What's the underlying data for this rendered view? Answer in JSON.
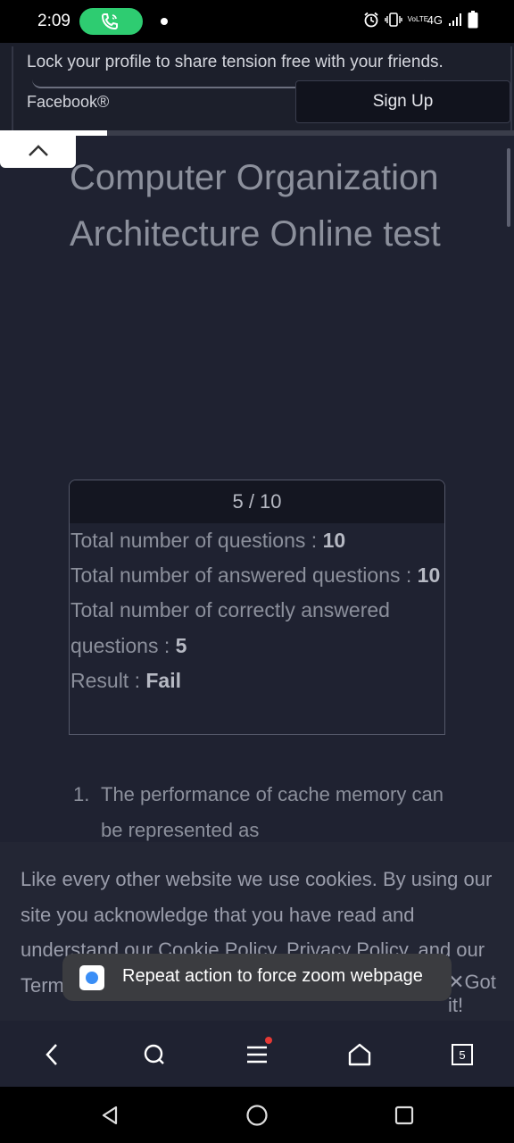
{
  "status_bar": {
    "time": "2:09",
    "network": "4G",
    "volte": "VoLTE",
    "icons": [
      "phone-call-icon",
      "alarm-icon",
      "vibrate-icon",
      "signal-icon",
      "battery-icon"
    ]
  },
  "banner": {
    "text": "Lock your profile to share tension free with your friends.",
    "brand": "Facebook®",
    "signup_label": "Sign Up"
  },
  "page": {
    "title": "Computer Organization Architecture Online test"
  },
  "result": {
    "score": "5 / 10",
    "total_label": "Total number of questions : ",
    "total_value": "10",
    "answered_label": "Total number of answered questions : ",
    "answered_value": "10",
    "correct_label": "Total number of correctly answered questions : ",
    "correct_value": "5",
    "result_label": "Result : ",
    "result_value": "Fail"
  },
  "question": {
    "number": "1.",
    "text": "The performance of cache memory can be represented as"
  },
  "cookie": {
    "text": "Like every other website we use cookies. By using our site you acknowledge that you have read and understand our Cookie Policy, Privacy Policy, and our Terms of Service. Learn more",
    "got_it": "Got it!"
  },
  "toast": {
    "text": "Repeat action to force zoom webpage"
  },
  "browser_bar": {
    "tab_count": "5"
  },
  "colors": {
    "background": "#1f2231",
    "call_pill": "#2ecc71",
    "notification_dot": "#e53935"
  }
}
